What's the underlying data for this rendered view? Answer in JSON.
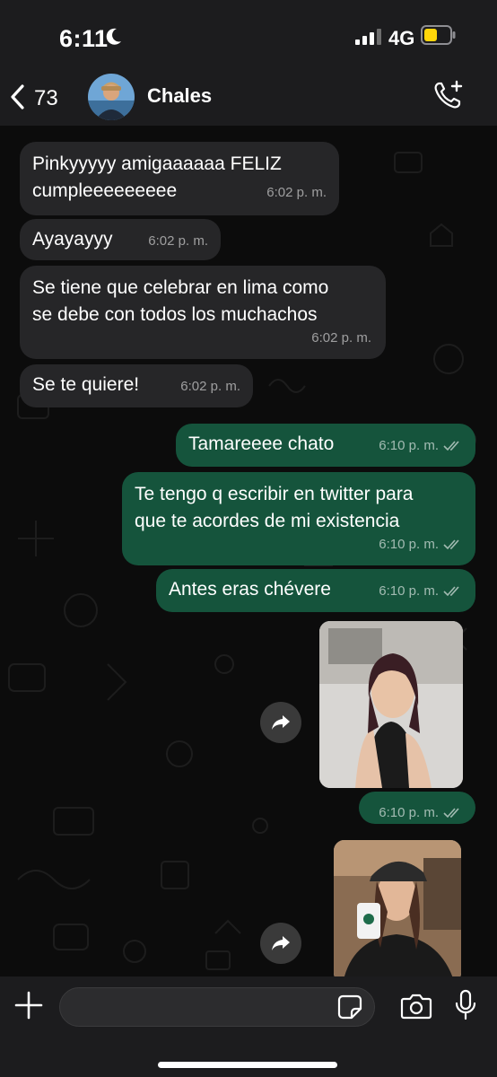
{
  "status_bar": {
    "time": "6:11",
    "network": "4G"
  },
  "header": {
    "back_count": "73",
    "contact_name": "Chales"
  },
  "messages": [
    {
      "direction": "in",
      "text": "Pinkyyyyy amigaaaaaa FELIZ\ncumpleeeeeeeee",
      "time": "6:02 p. m."
    },
    {
      "direction": "in",
      "text": "Ayayayyy",
      "time": "6:02 p. m."
    },
    {
      "direction": "in",
      "text": "Se tiene que celebrar en lima como\nse debe con todos los muchachos",
      "time": "6:02 p. m."
    },
    {
      "direction": "in",
      "text": "Se te quiere!",
      "time": "6:02 p. m."
    },
    {
      "direction": "out",
      "text": "Tamareeee chato",
      "time": "6:10 p. m."
    },
    {
      "direction": "out",
      "text": "Te tengo q escribir en twitter para\nque te acordes de mi existencia",
      "time": "6:10 p. m."
    },
    {
      "direction": "out",
      "text": "Antes eras chévere",
      "time": "6:10 p. m."
    },
    {
      "direction": "out",
      "type": "image",
      "time": "6:10 p. m."
    },
    {
      "direction": "out",
      "type": "image"
    }
  ],
  "composer": {
    "placeholder": ""
  },
  "colors": {
    "incoming_bubble": "#262628",
    "outgoing_bubble": "#15543c",
    "background": "#0c0c0c",
    "battery": "#ffd60a"
  },
  "icons": [
    "moon-icon",
    "signal-icon",
    "battery-icon",
    "back-chevron-icon",
    "add-call-icon",
    "forward-icon",
    "plus-icon",
    "sticker-icon",
    "camera-icon",
    "microphone-icon"
  ]
}
